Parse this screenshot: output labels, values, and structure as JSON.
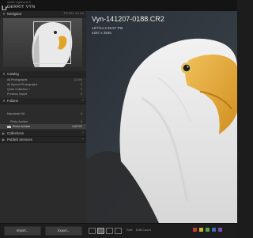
{
  "brand": {
    "logo_text": "Lr",
    "subtitle": "Adobe Lightroom 5",
    "user": "GERRIT VYN"
  },
  "navigator": {
    "title": "Navigator",
    "options": "FIT  FILL  1:1  3:1"
  },
  "catalog": {
    "title": "Catalog",
    "items": [
      {
        "label": "All Photographs",
        "count": "11,000"
      },
      {
        "label": "All Synced Photographs",
        "count": "0"
      },
      {
        "label": "Quick Collection +",
        "count": "0"
      },
      {
        "label": "Previous Import",
        "count": "0"
      }
    ]
  },
  "folders": {
    "title": "Folders",
    "add": "+",
    "drive": {
      "label": "Macintosh HD",
      "count": "0"
    },
    "items": [
      {
        "label": "Photo Archive",
        "count": "0"
      },
      {
        "label": "Photo Archive",
        "count": "168/780",
        "selected": true
      }
    ]
  },
  "collections": {
    "title": "Collections",
    "add": "+"
  },
  "publish": {
    "title": "Publish Services",
    "add": "+"
  },
  "photo": {
    "filename": "Vyn-141207-0188.CR2",
    "datetime": "12/7/14 2:25:57 PM",
    "dimensions": "4287 x 2845"
  },
  "bottombar": {
    "import_label": "Import...",
    "export_label": "Export...",
    "sort_label": "Sort:",
    "sort_value": "Edit Count"
  },
  "colors": {
    "accent_red": "#c33c36",
    "accent_yellow": "#d3b12e",
    "accent_green": "#58a24a",
    "accent_blue": "#3e6bbd",
    "accent_purple": "#7b4cb0"
  }
}
